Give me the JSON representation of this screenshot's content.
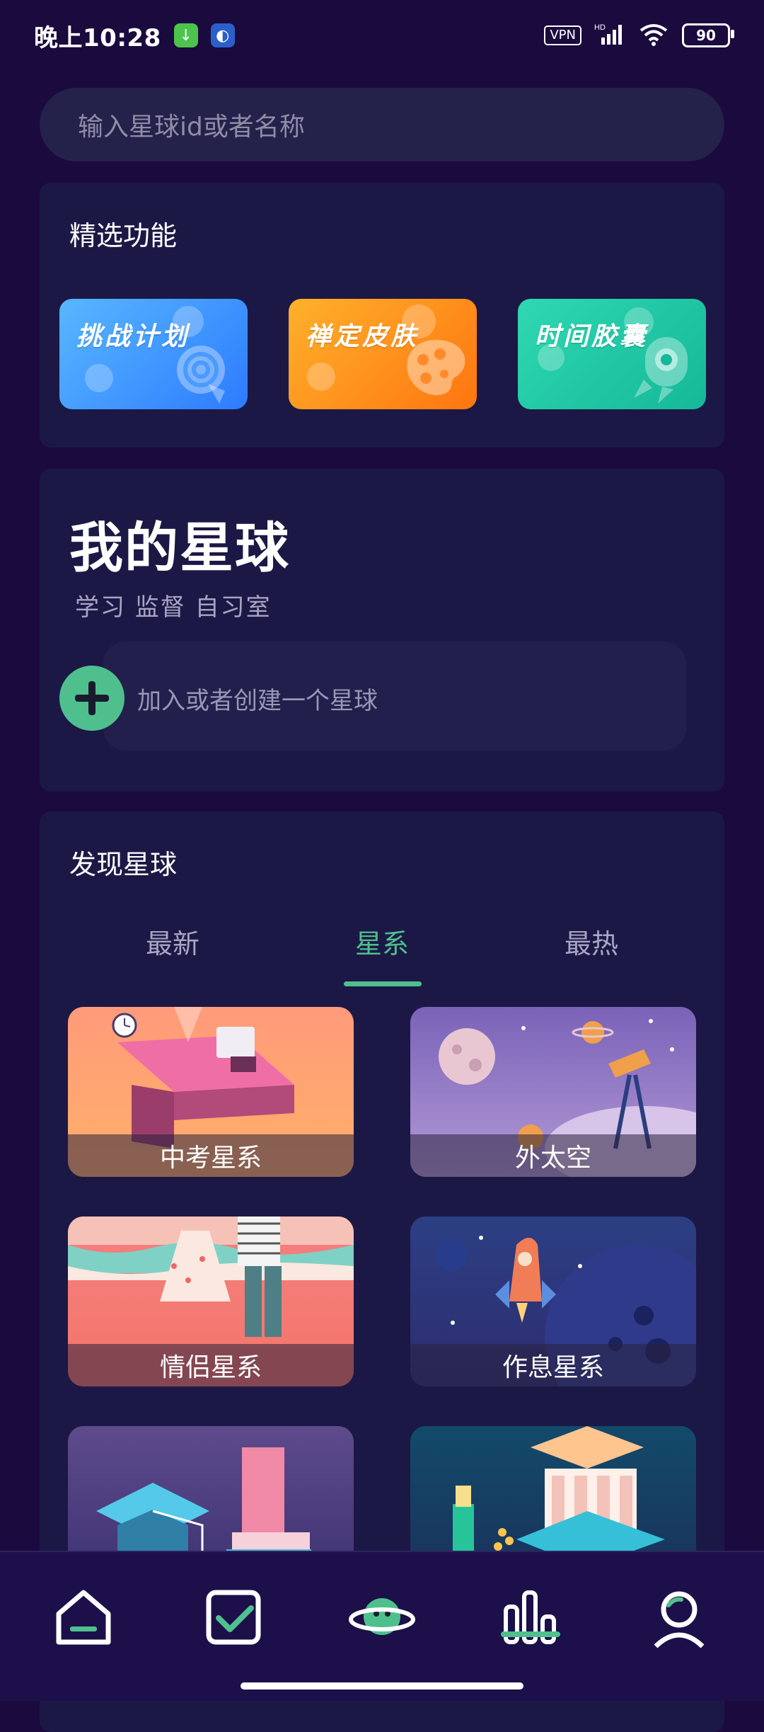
{
  "status_bar": {
    "time": "晚上10:28",
    "vpn": "VPN",
    "signal_badge": "HD",
    "battery": "90"
  },
  "search": {
    "placeholder": "输入星球id或者名称"
  },
  "featured": {
    "title": "精选功能",
    "items": [
      {
        "label": "挑战计划",
        "color": "#2d7bff",
        "icon": "target-icon"
      },
      {
        "label": "禅定皮肤",
        "color": "#ff7510",
        "icon": "palette-icon"
      },
      {
        "label": "时间胶囊",
        "color": "#15b898",
        "icon": "rocket-icon"
      }
    ]
  },
  "my_planet": {
    "title": "我的星球",
    "subtitle": "学习 监督 自习室",
    "join_text": "加入或者创建一个星球"
  },
  "discover": {
    "title": "发现星球",
    "tabs": [
      "最新",
      "星系",
      "最热"
    ],
    "active_tab": "星系",
    "tiles": [
      "中考星系",
      "外太空",
      "情侣星系",
      "作息星系",
      "",
      ""
    ]
  },
  "nav": {
    "items": [
      "home-icon",
      "check-icon",
      "planet-icon",
      "stats-icon",
      "profile-icon"
    ],
    "active": "stats-icon"
  },
  "colors": {
    "background": "#1a0a3e",
    "card": "#1c1846",
    "accent": "#4fc08d"
  }
}
